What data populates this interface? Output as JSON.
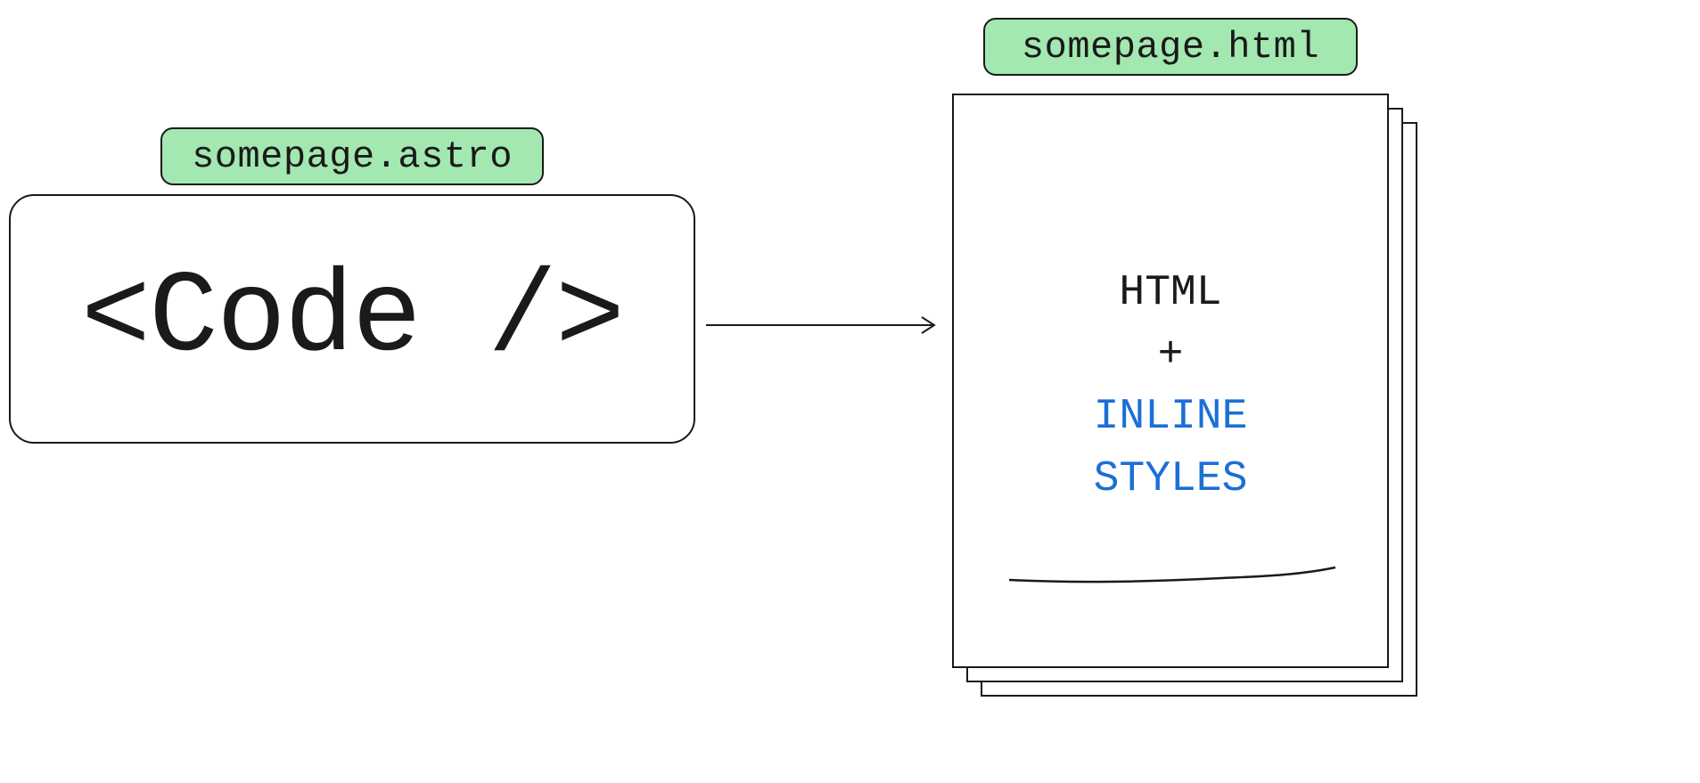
{
  "colors": {
    "labelBg": "#a3e8b1",
    "border": "#1a1a1a",
    "text": "#1a1a1a",
    "highlight": "#1b6fd6",
    "pageBg": "#ffffff"
  },
  "input": {
    "label": "somepage.astro",
    "content": "<Code />"
  },
  "output": {
    "label": "somepage.html",
    "line1": "HTML",
    "line2": "+",
    "line3a": "INLINE",
    "line3b": "STYLES"
  }
}
